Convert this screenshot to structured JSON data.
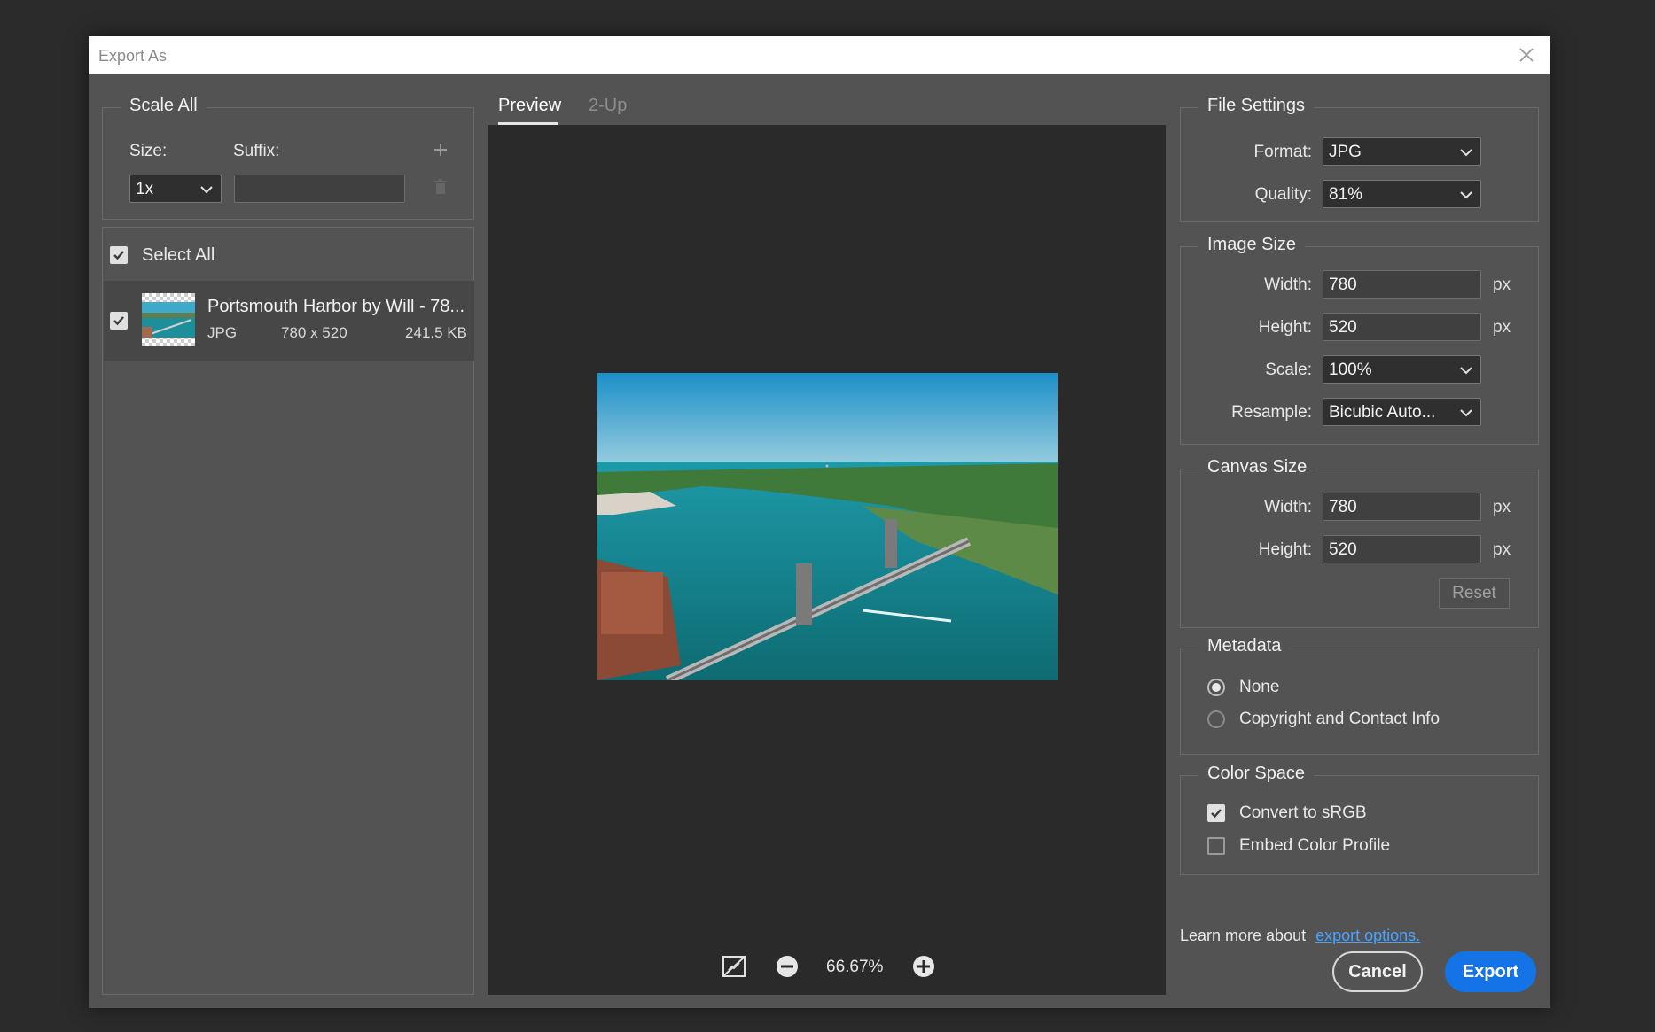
{
  "window": {
    "title": "Export As"
  },
  "scale_all": {
    "legend": "Scale All",
    "size_label": "Size:",
    "suffix_label": "Suffix:",
    "size_value": "1x",
    "suffix_value": "",
    "add_icon": "plus-icon",
    "delete_icon": "trash-icon"
  },
  "select_all": {
    "label": "Select All",
    "checked": true
  },
  "file": {
    "name": "Portsmouth Harbor by Will - 78...",
    "format": "JPG",
    "dimensions": "780 x 520",
    "size": "241.5 KB",
    "checked": true
  },
  "preview": {
    "tabs": [
      {
        "label": "Preview",
        "active": true
      },
      {
        "label": "2-Up",
        "active": false
      }
    ],
    "zoom": "66.67%"
  },
  "file_settings": {
    "legend": "File Settings",
    "format_label": "Format:",
    "format_value": "JPG",
    "quality_label": "Quality:",
    "quality_value": "81%"
  },
  "image_size": {
    "legend": "Image Size",
    "width_label": "Width:",
    "width_value": "780",
    "height_label": "Height:",
    "height_value": "520",
    "unit": "px",
    "scale_label": "Scale:",
    "scale_value": "100%",
    "resample_label": "Resample:",
    "resample_value": "Bicubic Auto..."
  },
  "canvas_size": {
    "legend": "Canvas Size",
    "width_label": "Width:",
    "width_value": "780",
    "height_label": "Height:",
    "height_value": "520",
    "unit": "px",
    "reset_label": "Reset"
  },
  "metadata": {
    "legend": "Metadata",
    "options": [
      {
        "label": "None",
        "selected": true
      },
      {
        "label": "Copyright and Contact Info",
        "selected": false
      }
    ]
  },
  "color_space": {
    "legend": "Color Space",
    "convert_label": "Convert to sRGB",
    "convert_checked": true,
    "embed_label": "Embed Color Profile",
    "embed_checked": false
  },
  "learn_more": {
    "text": "Learn more about",
    "link": "export options."
  },
  "actions": {
    "cancel": "Cancel",
    "export": "Export"
  },
  "colors": {
    "accent": "#1473e6",
    "link": "#4aa3ff",
    "dialog_bg": "#535353"
  }
}
